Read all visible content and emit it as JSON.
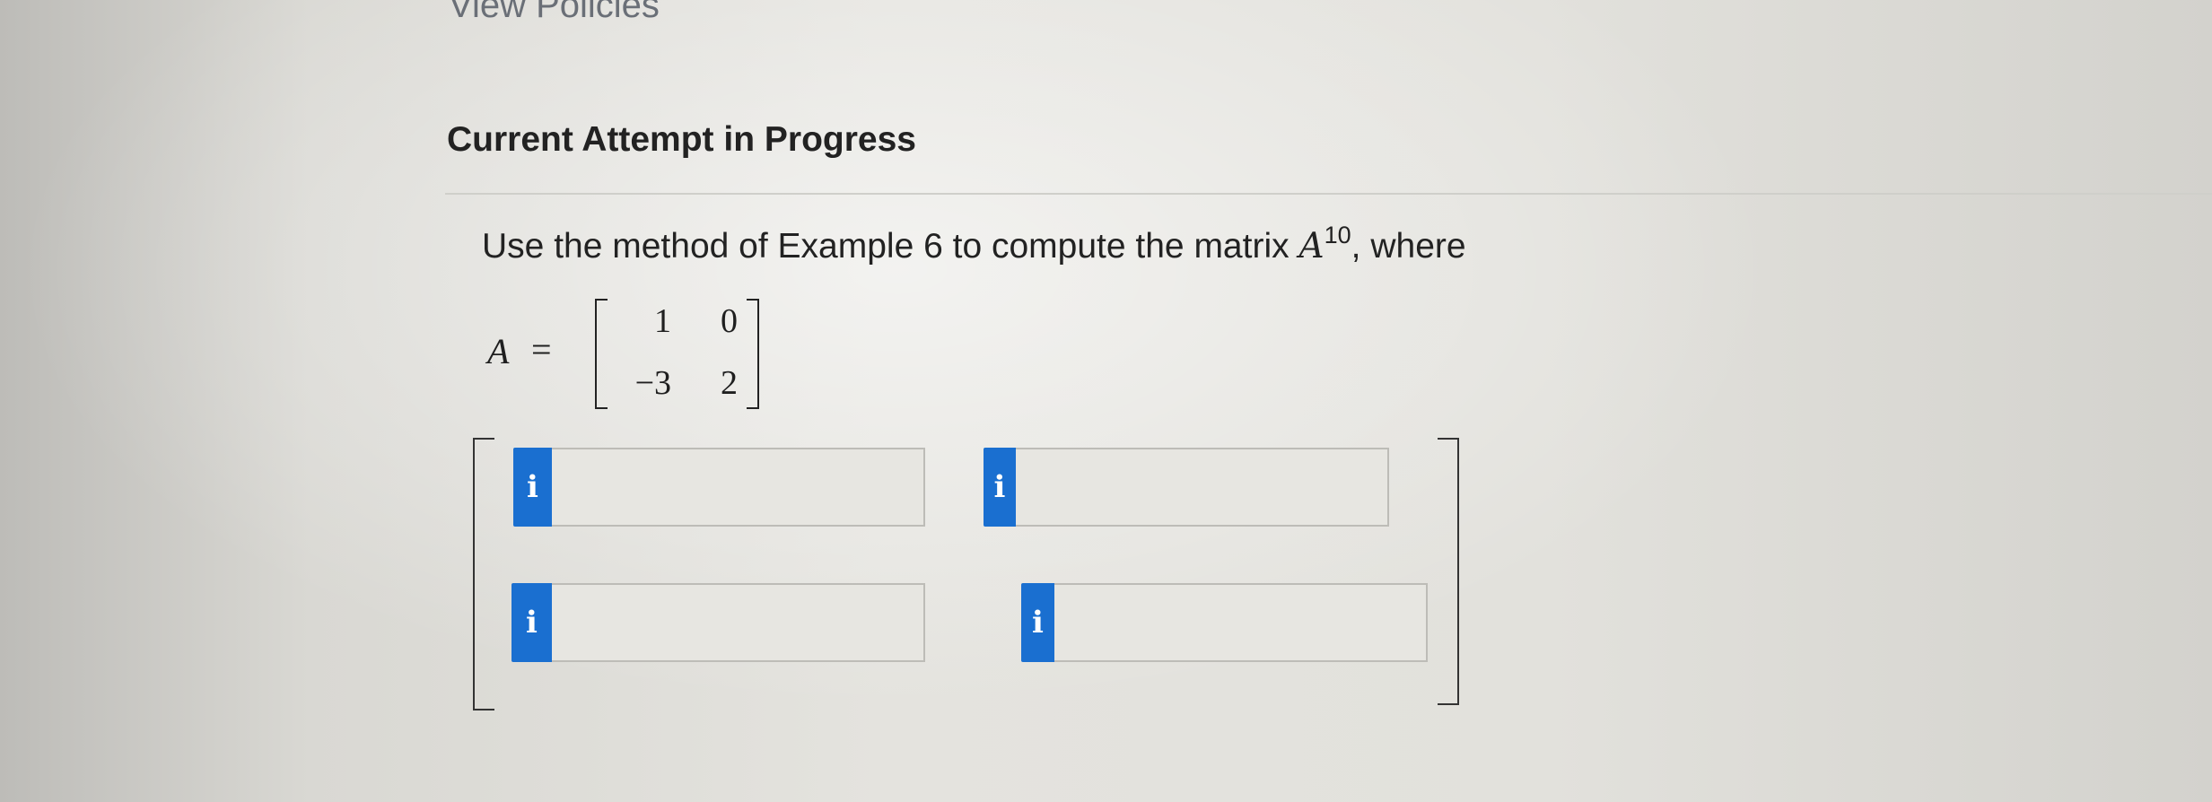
{
  "header": {
    "view_policies_link": "View Policies"
  },
  "attempt": {
    "title": "Current Attempt in Progress"
  },
  "question": {
    "text_before": "Use the method of Example 6 to compute the matrix ",
    "matrix_symbol": "A",
    "exponent": "10",
    "text_after": ", where"
  },
  "matrix_definition": {
    "variable": "A",
    "equals": "=",
    "rows": [
      [
        "1",
        "0"
      ],
      [
        "−3",
        "2"
      ]
    ]
  },
  "answer_matrix": {
    "info_icon_glyph": "i",
    "cells": [
      {
        "value": ""
      },
      {
        "value": ""
      },
      {
        "value": ""
      },
      {
        "value": ""
      }
    ]
  },
  "colors": {
    "info_button": "#1a6fd0",
    "input_border": "#bdbcb7",
    "link": "#6a6f77"
  }
}
